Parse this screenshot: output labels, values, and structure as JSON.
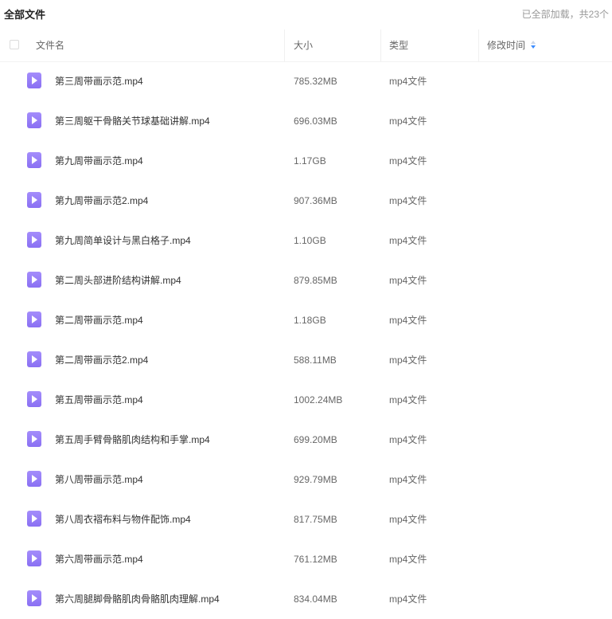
{
  "header": {
    "title": "全部文件",
    "status": "已全部加载，共23个"
  },
  "columns": {
    "name": "文件名",
    "size": "大小",
    "type": "类型",
    "modified": "修改时间"
  },
  "files": [
    {
      "name": "第三周带画示范.mp4",
      "size": "785.32MB",
      "type": "mp4文件",
      "modified": ""
    },
    {
      "name": "第三周躯干骨骼关节球基础讲解.mp4",
      "size": "696.03MB",
      "type": "mp4文件",
      "modified": ""
    },
    {
      "name": "第九周带画示范.mp4",
      "size": "1.17GB",
      "type": "mp4文件",
      "modified": ""
    },
    {
      "name": "第九周带画示范2.mp4",
      "size": "907.36MB",
      "type": "mp4文件",
      "modified": ""
    },
    {
      "name": "第九周简单设计与黑白格子.mp4",
      "size": "1.10GB",
      "type": "mp4文件",
      "modified": ""
    },
    {
      "name": "第二周头部进阶结构讲解.mp4",
      "size": "879.85MB",
      "type": "mp4文件",
      "modified": ""
    },
    {
      "name": "第二周带画示范.mp4",
      "size": "1.18GB",
      "type": "mp4文件",
      "modified": ""
    },
    {
      "name": "第二周带画示范2.mp4",
      "size": "588.11MB",
      "type": "mp4文件",
      "modified": ""
    },
    {
      "name": "第五周带画示范.mp4",
      "size": "1002.24MB",
      "type": "mp4文件",
      "modified": ""
    },
    {
      "name": "第五周手臂骨骼肌肉结构和手掌.mp4",
      "size": "699.20MB",
      "type": "mp4文件",
      "modified": ""
    },
    {
      "name": "第八周带画示范.mp4",
      "size": "929.79MB",
      "type": "mp4文件",
      "modified": ""
    },
    {
      "name": "第八周衣褶布料与物件配饰.mp4",
      "size": "817.75MB",
      "type": "mp4文件",
      "modified": ""
    },
    {
      "name": "第六周带画示范.mp4",
      "size": "761.12MB",
      "type": "mp4文件",
      "modified": ""
    },
    {
      "name": "第六周腿脚骨骼肌肉骨骼肌肉理解.mp4",
      "size": "834.04MB",
      "type": "mp4文件",
      "modified": ""
    }
  ]
}
